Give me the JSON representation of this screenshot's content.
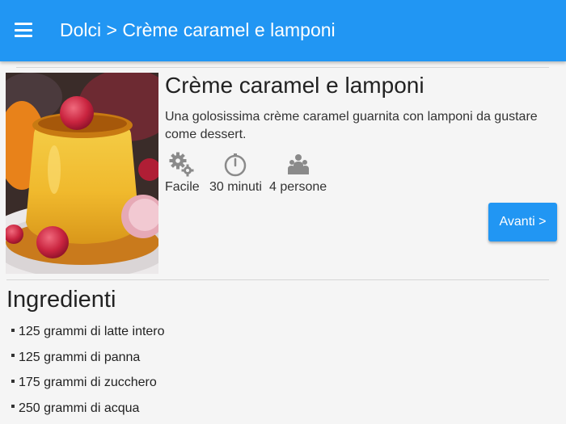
{
  "appbar": {
    "menu_icon": "hamburger-menu-icon",
    "title": "Dolci > Crème caramel e lamponi",
    "color": "#2196f3"
  },
  "recipe": {
    "title": "Crème caramel e lamponi",
    "description": "Una golosissima crème caramel guarnita con lamponi da gustare come dessert.",
    "meta": [
      {
        "icon": "gears-icon",
        "label": "Facile"
      },
      {
        "icon": "clock-icon",
        "label": "30 minuti"
      },
      {
        "icon": "people-icon",
        "label": "4 persone"
      }
    ],
    "next_label": "Avanti >"
  },
  "ingredients": {
    "title": "Ingredienti",
    "items": [
      "125 grammi di latte intero",
      "125 grammi di panna",
      "175 grammi di zucchero",
      "250 grammi di acqua"
    ]
  }
}
